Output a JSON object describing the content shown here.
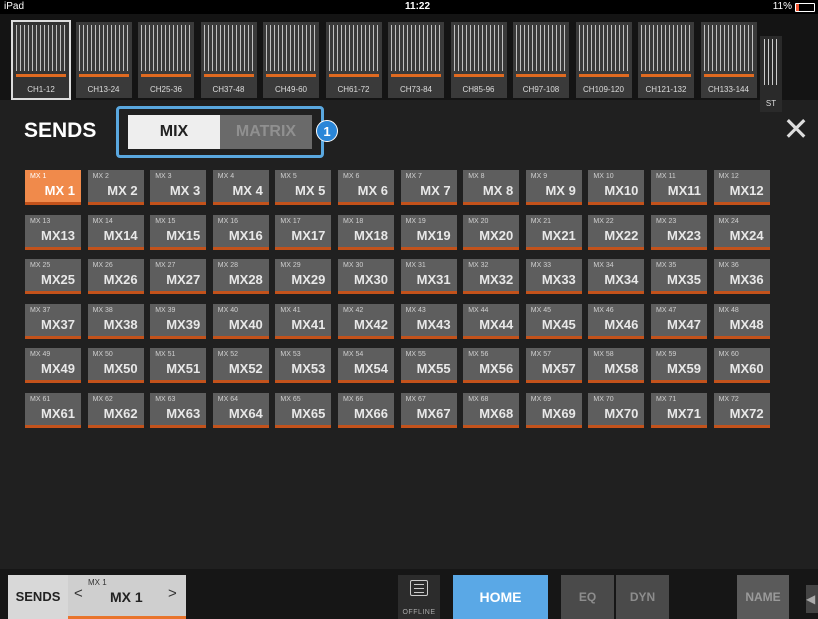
{
  "status": {
    "device": "iPad",
    "time": "11:22",
    "battery": "11%"
  },
  "channel_banks": [
    "CH1-12",
    "CH13-24",
    "CH25-36",
    "CH37-48",
    "CH49-60",
    "CH61-72",
    "CH73-84",
    "CH85-96",
    "CH97-108",
    "CH109-120",
    "CH121-132",
    "CH133-144"
  ],
  "stereo_label": "ST",
  "header": {
    "title": "SENDS",
    "mix": "MIX",
    "matrix": "MATRIX",
    "callout": "1"
  },
  "mix_buttons": [
    [
      "MX 1",
      "MX 1"
    ],
    [
      "MX 2",
      "MX 2"
    ],
    [
      "MX 3",
      "MX 3"
    ],
    [
      "MX 4",
      "MX 4"
    ],
    [
      "MX 5",
      "MX 5"
    ],
    [
      "MX 6",
      "MX 6"
    ],
    [
      "MX 7",
      "MX 7"
    ],
    [
      "MX 8",
      "MX 8"
    ],
    [
      "MX 9",
      "MX 9"
    ],
    [
      "MX 10",
      "MX10"
    ],
    [
      "MX 11",
      "MX11"
    ],
    [
      "MX 12",
      "MX12"
    ],
    [
      "MX 13",
      "MX13"
    ],
    [
      "MX 14",
      "MX14"
    ],
    [
      "MX 15",
      "MX15"
    ],
    [
      "MX 16",
      "MX16"
    ],
    [
      "MX 17",
      "MX17"
    ],
    [
      "MX 18",
      "MX18"
    ],
    [
      "MX 19",
      "MX19"
    ],
    [
      "MX 20",
      "MX20"
    ],
    [
      "MX 21",
      "MX21"
    ],
    [
      "MX 22",
      "MX22"
    ],
    [
      "MX 23",
      "MX23"
    ],
    [
      "MX 24",
      "MX24"
    ],
    [
      "MX 25",
      "MX25"
    ],
    [
      "MX 26",
      "MX26"
    ],
    [
      "MX 27",
      "MX27"
    ],
    [
      "MX 28",
      "MX28"
    ],
    [
      "MX 29",
      "MX29"
    ],
    [
      "MX 30",
      "MX30"
    ],
    [
      "MX 31",
      "MX31"
    ],
    [
      "MX 32",
      "MX32"
    ],
    [
      "MX 33",
      "MX33"
    ],
    [
      "MX 34",
      "MX34"
    ],
    [
      "MX 35",
      "MX35"
    ],
    [
      "MX 36",
      "MX36"
    ],
    [
      "MX 37",
      "MX37"
    ],
    [
      "MX 38",
      "MX38"
    ],
    [
      "MX 39",
      "MX39"
    ],
    [
      "MX 40",
      "MX40"
    ],
    [
      "MX 41",
      "MX41"
    ],
    [
      "MX 42",
      "MX42"
    ],
    [
      "MX 43",
      "MX43"
    ],
    [
      "MX 44",
      "MX44"
    ],
    [
      "MX 45",
      "MX45"
    ],
    [
      "MX 46",
      "MX46"
    ],
    [
      "MX 47",
      "MX47"
    ],
    [
      "MX 48",
      "MX48"
    ],
    [
      "MX 49",
      "MX49"
    ],
    [
      "MX 50",
      "MX50"
    ],
    [
      "MX 51",
      "MX51"
    ],
    [
      "MX 52",
      "MX52"
    ],
    [
      "MX 53",
      "MX53"
    ],
    [
      "MX 54",
      "MX54"
    ],
    [
      "MX 55",
      "MX55"
    ],
    [
      "MX 56",
      "MX56"
    ],
    [
      "MX 57",
      "MX57"
    ],
    [
      "MX 58",
      "MX58"
    ],
    [
      "MX 59",
      "MX59"
    ],
    [
      "MX 60",
      "MX60"
    ],
    [
      "MX 61",
      "MX61"
    ],
    [
      "MX 62",
      "MX62"
    ],
    [
      "MX 63",
      "MX63"
    ],
    [
      "MX 64",
      "MX64"
    ],
    [
      "MX 65",
      "MX65"
    ],
    [
      "MX 66",
      "MX66"
    ],
    [
      "MX 67",
      "MX67"
    ],
    [
      "MX 68",
      "MX68"
    ],
    [
      "MX 69",
      "MX69"
    ],
    [
      "MX 70",
      "MX70"
    ],
    [
      "MX 71",
      "MX71"
    ],
    [
      "MX 72",
      "MX72"
    ]
  ],
  "selected_mix": "MX 1",
  "bottom": {
    "sends": "SENDS",
    "prev": "<",
    "next": ">",
    "sel_small": "MX 1",
    "sel_large": "MX 1",
    "offline": "OFFLINE",
    "home": "HOME",
    "eq": "EQ",
    "dyn": "DYN",
    "name": "NAME"
  },
  "colors": {
    "accent_orange": "#e8742c",
    "home_blue": "#5aa8e6",
    "callout_blue": "#2a86d8"
  }
}
